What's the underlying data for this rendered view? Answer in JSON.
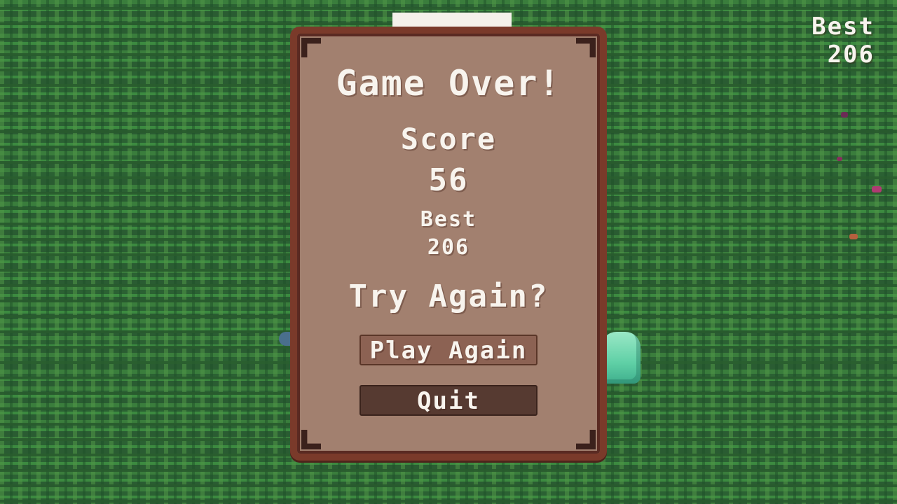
{
  "hud": {
    "best_label": "Best",
    "best_value": "206"
  },
  "dialog": {
    "title": "Game Over!",
    "score_label": "Score",
    "score_value": "56",
    "best_label": "Best",
    "best_value": "206",
    "prompt": "Try Again?",
    "play_again_label": "Play Again",
    "quit_label": "Quit"
  },
  "colors": {
    "grass": "#2f6a36",
    "panel": "#a2806f",
    "panel_border": "#7a3a2a",
    "text": "#f8f4ee",
    "play_button": "#8c6253",
    "quit_button": "#563a31"
  }
}
